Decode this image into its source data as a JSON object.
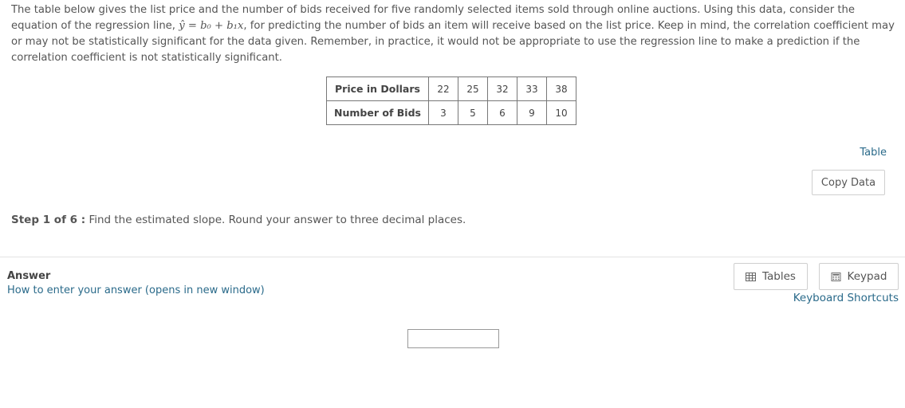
{
  "problem": {
    "text_before": "The table below gives the list price and the number of bids received for five randomly selected items sold through online auctions. Using this data, consider the equation of the regression line, ",
    "equation": "ŷ = b₀ + b₁x",
    "text_after": ", for predicting the number of bids an item will receive based on the list price. Keep in mind, the correlation coefficient may or may not be statistically significant for the data given. Remember, in practice, it would not be appropriate to use the regression line to make a prediction if the correlation coefficient is not statistically significant."
  },
  "table": {
    "row1_header": "Price in Dollars",
    "row1": [
      "22",
      "25",
      "32",
      "33",
      "38"
    ],
    "row2_header": "Number of Bids",
    "row2": [
      "3",
      "5",
      "6",
      "9",
      "10"
    ]
  },
  "links": {
    "table": "Table",
    "how_to": "How to enter your answer (opens in new window)",
    "keyboard_shortcuts": "Keyboard Shortcuts"
  },
  "buttons": {
    "copy_data": "Copy Data",
    "tables": "Tables",
    "keypad": "Keypad"
  },
  "step": {
    "label": "Step 1 of 6 :",
    "instruction": "Find the estimated slope. Round your answer to three decimal places."
  },
  "answer": {
    "label": "Answer",
    "value": ""
  },
  "icons": {
    "tables": "table-grid-icon",
    "keypad": "keypad-icon"
  }
}
